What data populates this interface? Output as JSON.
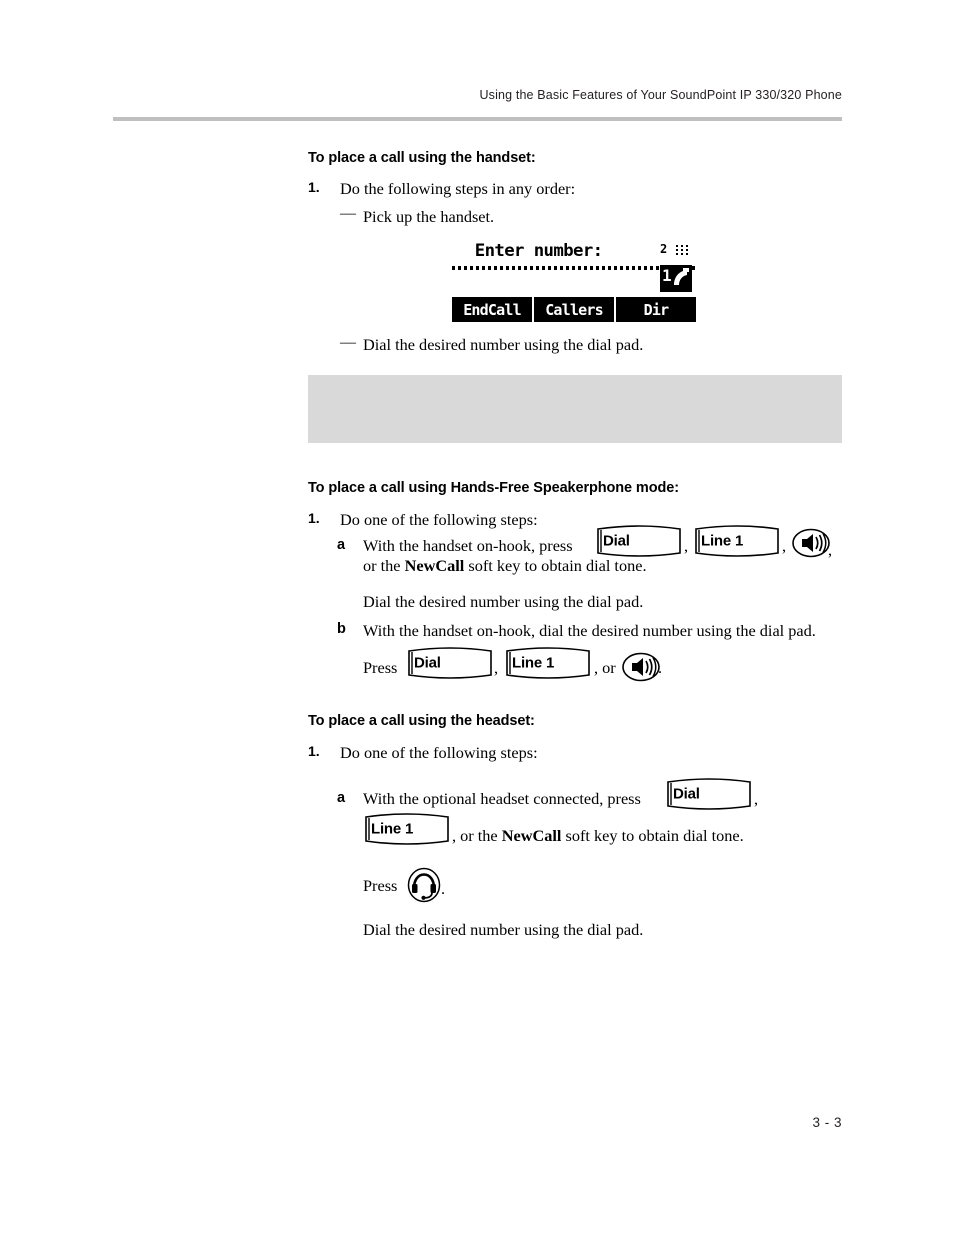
{
  "document": {
    "running_header": "Using the Basic Features of Your SoundPoint IP 330/320 Phone",
    "page_number": "3 - 3"
  },
  "sections": [
    {
      "heading": "To place a call using the handset:",
      "step_number": "1.",
      "step_text": "Do the following steps in any order:",
      "bullets": [
        {
          "marker": "—",
          "text": "Pick up the handset."
        },
        {
          "marker": "—",
          "text": "Dial the desired number using the dial pad."
        }
      ]
    },
    {
      "heading": "To place a call using Hands-Free Speakerphone mode:",
      "step_number": "1.",
      "step_text": "Do one of the following steps:",
      "items": [
        {
          "marker": "a",
          "line1_before": "With the handset on-hook, press",
          "line2_a": "or the",
          "line2_b": "NewCall",
          "line2_c": "soft key to obtain dial tone.",
          "follow_up": "Dial the desired number using the dial pad."
        },
        {
          "marker": "b",
          "line1": "With the handset on-hook, dial the desired number using the dial pad.",
          "press_label": "Press",
          "or_label": ", or"
        }
      ]
    },
    {
      "heading": "To place a call using the headset:",
      "step_number": "1.",
      "step_text": "Do one of the following steps:",
      "items": [
        {
          "marker": "a",
          "line1": "With the optional headset connected, press",
          "line2_a": ", or the",
          "line2_b": "NewCall",
          "line2_c": "soft key to obtain dial tone.",
          "press_label": "Press",
          "follow_up": "Dial the desired number using the dial pad."
        }
      ]
    }
  ],
  "keys": {
    "dial": "Dial",
    "line1": "Line 1"
  },
  "lcd": {
    "title": "Enter number:",
    "line_digit": "2",
    "active_line": "1",
    "softkeys": [
      "EndCall",
      "Callers",
      "Dir"
    ],
    "icons": {
      "grid": "dial-pad-grid-icon",
      "handset": "off-hook-handset-icon"
    }
  },
  "icons": {
    "speaker": "speakerphone-icon",
    "headset": "headset-icon"
  },
  "colors": {
    "rule": "#bfbfbf",
    "gray_box": "#d9d9d9",
    "text": "#000000",
    "header_text": "#231f20"
  },
  "punctuation": {
    "comma": ",",
    "period": ".",
    "comma_period": ",",
    "trailing_comma": ","
  }
}
